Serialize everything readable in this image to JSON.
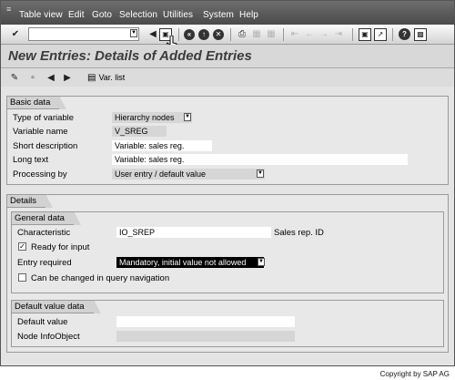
{
  "menubar": {
    "items": [
      "Table view",
      "Edit",
      "Goto",
      "Selection",
      "Utilities",
      "System",
      "Help"
    ]
  },
  "toolbar": {
    "command_value": "",
    "icons": [
      "enter-icon",
      "back-arrow-icon",
      "save-icon",
      "back-icon",
      "exit-icon",
      "cancel-icon",
      "print-icon",
      "find-icon",
      "find-next-icon",
      "first-page-icon",
      "previous-page-icon",
      "next-page-icon",
      "last-page-icon",
      "create-session-icon",
      "shortcut-icon",
      "help-icon",
      "layout-icon"
    ]
  },
  "title": "New Entries: Details of Added Entries",
  "app_toolbar": {
    "var_list_label": "Var. list"
  },
  "basic_data": {
    "title": "Basic data",
    "type_label": "Type of variable",
    "type_value": "Hierarchy nodes",
    "name_label": "Variable name",
    "name_value": "V_SREG",
    "short_desc_label": "Short description",
    "short_desc_value": "Variable: sales reg.",
    "long_text_label": "Long text",
    "long_text_value": "Variable: sales reg.",
    "processing_label": "Processing by",
    "processing_value": "User entry / default value"
  },
  "details": {
    "title": "Details",
    "general": {
      "title": "General data",
      "characteristic_label": "Characteristic",
      "characteristic_value": "IO_SREP",
      "characteristic_desc": "Sales rep. ID",
      "ready_label": "Ready for input",
      "ready_checked": true,
      "entry_required_label": "Entry required",
      "entry_required_value": "Mandatory, initial value not allowed",
      "changeable_label": "Can be changed in query navigation",
      "changeable_checked": false
    },
    "default_value": {
      "title": "Default value data",
      "default_label": "Default value",
      "default_value": "",
      "node_label": "Node InfoObject",
      "node_value": ""
    }
  },
  "copyright": "Copyright by SAP AG"
}
